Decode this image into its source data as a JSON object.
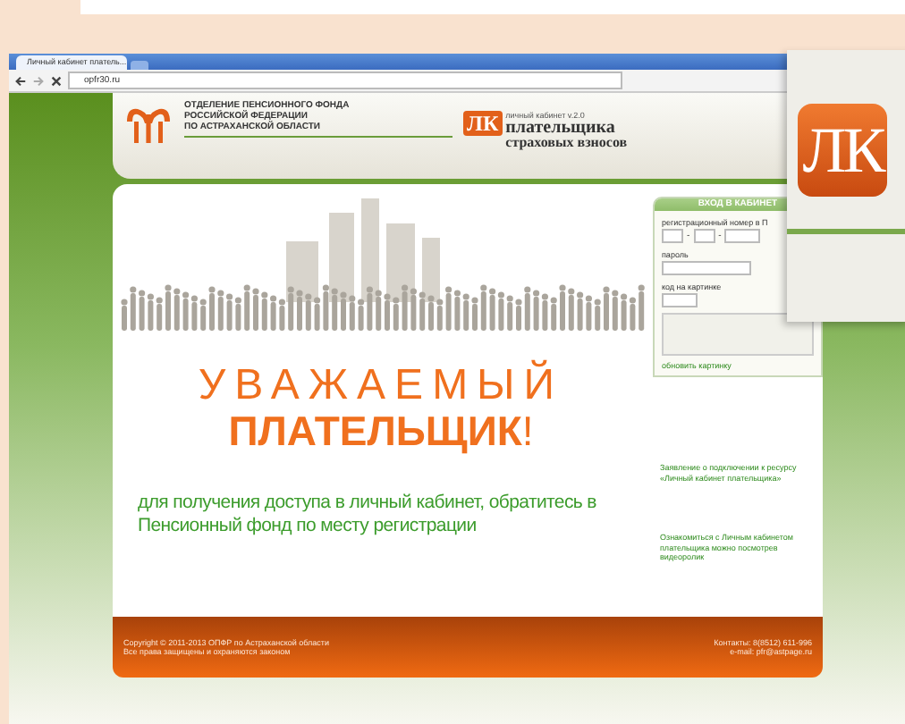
{
  "browser": {
    "tab_title": "Личный кабинет платель...",
    "url": "opfr30.ru"
  },
  "header": {
    "org_lines": [
      "ОТДЕЛЕНИЕ ПЕНСИОННОГО ФОНДА",
      "РОССИЙСКОЙ ФЕДЕРАЦИИ",
      "ПО АСТРАХАНСКОЙ ОБЛАСТИ"
    ],
    "logo_mark": "ЛК",
    "version": "личный кабинет v.2.0",
    "title": "плательщика",
    "subtitle": "страховых взносов"
  },
  "greeting": {
    "line_1": "УВАЖАЕМЫЙ",
    "line_2": "ПЛАТЕЛЬЩИК",
    "exclamation": "!",
    "message": "для получения доступа в личный кабинет, обратитесь в Пенсионный фонд по месту регистрации"
  },
  "login": {
    "title": "ВХОД В КАБИНЕТ",
    "reg_label": "регистрационный номер в П",
    "separator": "-",
    "password_label": "пароль",
    "captcha_label": "код на картинке",
    "refresh_link": "обновить картинку"
  },
  "links": [
    "Заявление о подключении к ресурсу «Личный кабинет плательщика»",
    "Ознакомиться с Личным кабинетом плательщика можно посмотрев видеоролик"
  ],
  "footer": {
    "copyright": [
      "Copyright © 2011-2013 ОПФР по Астраханской области",
      "Все права защищены и охраняются законом"
    ],
    "contacts": [
      "Контакты: 8(8512) 611-996",
      "e-mail: pfr@astpage.ru"
    ]
  },
  "zoom_overlay": {
    "logo_mark": "ЛК"
  }
}
